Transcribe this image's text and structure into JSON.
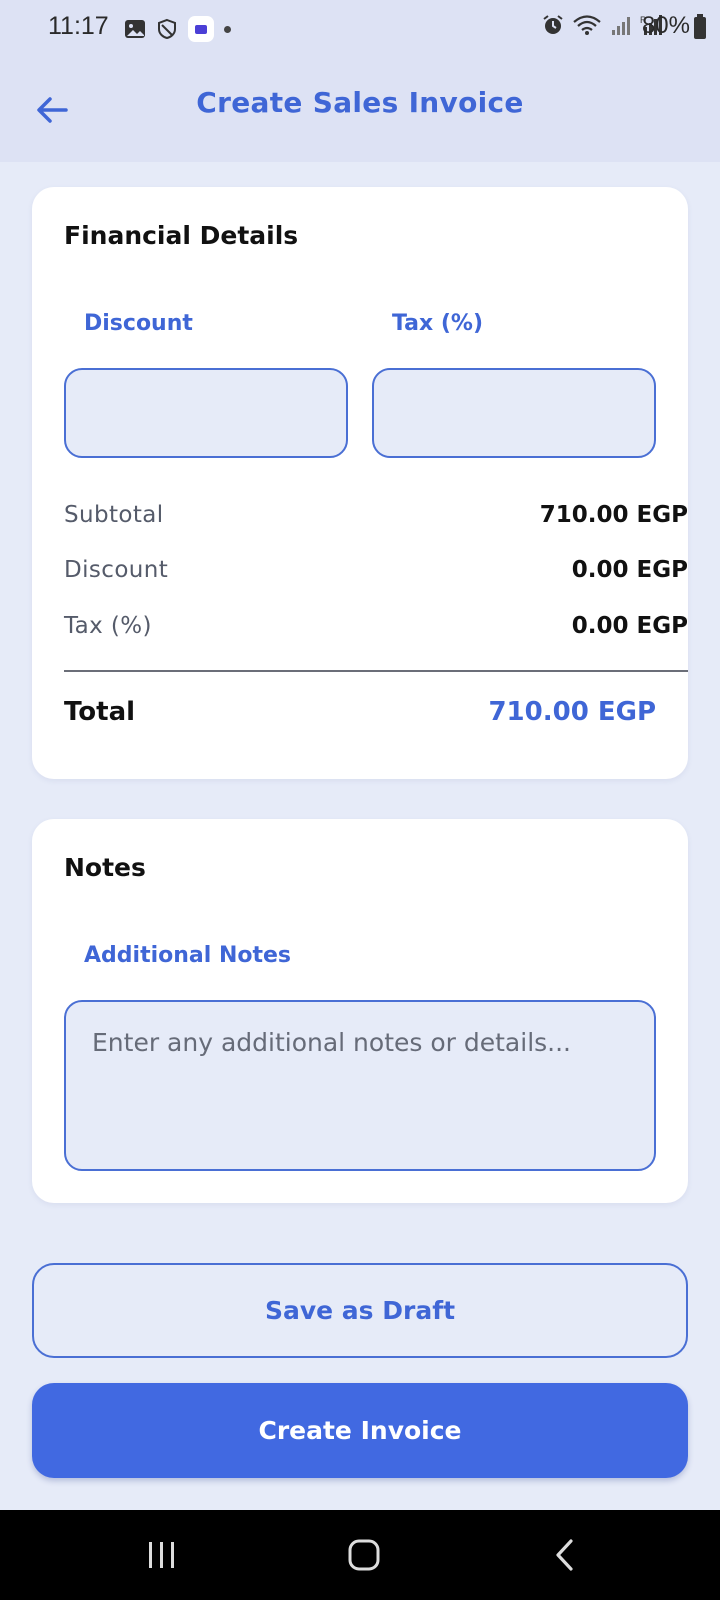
{
  "status_bar": {
    "time": "11:17",
    "battery": "80%",
    "icons": [
      "gallery-icon",
      "shield-icon",
      "app-badge-icon",
      "notification-dot",
      "alarm-icon",
      "wifi-icon",
      "signal-icon",
      "signal-r-icon",
      "battery-icon"
    ]
  },
  "header": {
    "title": "Create Sales Invoice",
    "back_icon": "arrow-left-icon"
  },
  "financial": {
    "title": "Financial Details",
    "discount_label": "Discount",
    "discount_value": "",
    "tax_label": "Tax (%)",
    "tax_value": "",
    "rows": [
      {
        "label": "Subtotal",
        "value": "710.00 EGP"
      },
      {
        "label": "Discount",
        "value": "0.00 EGP"
      },
      {
        "label": "Tax (%)",
        "value": "0.00 EGP"
      }
    ],
    "total_label": "Total",
    "total_value": "710.00 EGP"
  },
  "notes": {
    "title": "Notes",
    "field_label": "Additional Notes",
    "placeholder": "Enter any additional notes or details...",
    "value": ""
  },
  "actions": {
    "save_draft_label": "Save as Draft",
    "create_label": "Create Invoice"
  },
  "system_nav": {
    "items": [
      "recent-apps-icon",
      "home-icon",
      "back-icon"
    ]
  },
  "colors": {
    "accent": "#4169e1",
    "accent_text": "#3f66d6",
    "background": "#e6ebf8",
    "header_bg": "#dde2f4",
    "card": "#ffffff"
  }
}
